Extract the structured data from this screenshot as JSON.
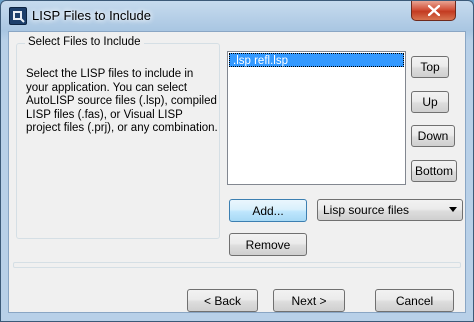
{
  "window": {
    "title": "LISP Files to Include",
    "app_icon": "autocad-app-icon",
    "close_icon": "close-icon"
  },
  "group": {
    "title": "Select Files to Include",
    "description": "Select the LISP files to include in your application.  You can select AutoLISP source files (.lsp), compiled LISP files (.fas), or Visual LISP project files (.prj), or any combination."
  },
  "file_list": {
    "items": [
      ".lsp refl.lsp"
    ],
    "selected_index": 0
  },
  "order_buttons": {
    "top": "Top",
    "up": "Up",
    "down": "Down",
    "bottom": "Bottom"
  },
  "actions": {
    "add": "Add...",
    "remove": "Remove",
    "file_type_selected": "Lisp source files"
  },
  "wizard": {
    "back": "< Back",
    "next": "Next >",
    "cancel": "Cancel"
  }
}
